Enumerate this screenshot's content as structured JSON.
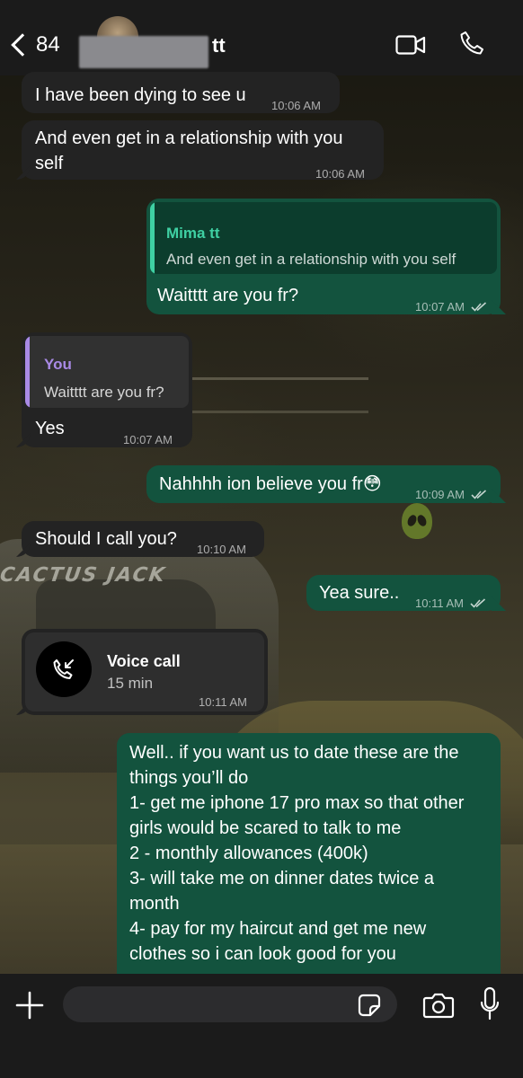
{
  "header": {
    "back_count": "84",
    "contact_name": "tt",
    "icons": {
      "back": "chevron-left-icon",
      "video": "video-call-icon",
      "phone": "phone-icon"
    }
  },
  "messages": [
    {
      "direction": "incoming",
      "text": "I have been dying to see u",
      "time": "10:06 AM"
    },
    {
      "direction": "incoming",
      "text_lines": [
        "And even get in a relationship with you",
        "self"
      ],
      "time": "10:06 AM"
    },
    {
      "direction": "outgoing",
      "reply_to": {
        "name": "Mima tt",
        "text": "And even get in a relationship with you self"
      },
      "text": "Waitttt are you fr?",
      "time": "10:07 AM"
    },
    {
      "direction": "incoming",
      "reply_to": {
        "name": "You",
        "text": "Waitttt are you fr?"
      },
      "text": "Yes",
      "time": "10:07 AM"
    },
    {
      "direction": "outgoing",
      "text": "Nahhhh ion believe you fr😳",
      "time": "10:09 AM"
    },
    {
      "direction": "incoming",
      "text": "Should I call you?",
      "time": "10:10 AM"
    },
    {
      "direction": "outgoing",
      "text": "Yea sure..",
      "time": "10:11 AM"
    },
    {
      "direction": "incoming",
      "type": "call",
      "title": "Voice call",
      "duration": "15 min",
      "time": "10:11 AM"
    },
    {
      "direction": "outgoing",
      "text_lines": [
        "Well.. if you want us to date these are the",
        "things you’ll do",
        "1- get me iphone 17 pro max so that other",
        "girls would be scared to talk to me",
        "2 - monthly allowances (400k)",
        "3-  will take me on dinner dates twice a",
        "month",
        "4- pay for my haircut and get me new",
        "clothes so i can look good for you"
      ]
    }
  ],
  "wallpaper": {
    "text": "CACTUS JACK"
  },
  "colors": {
    "incoming_bubble": "#232323",
    "outgoing_bubble": "#13533e",
    "reply_you": "#a98ae6",
    "reply_contact": "#3fd0a3"
  },
  "input": {
    "placeholder": ""
  }
}
